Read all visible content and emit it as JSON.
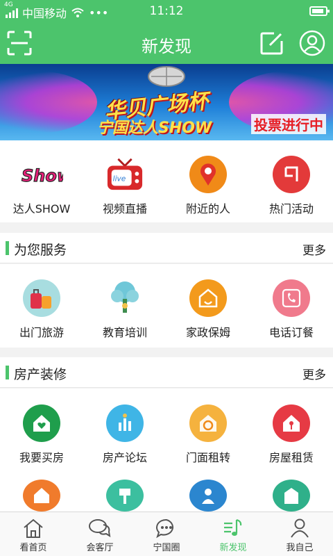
{
  "status": {
    "carrier": "中国移动",
    "network": "4G",
    "dots": "•••",
    "time": "11:12"
  },
  "header": {
    "title": "新发现",
    "left_icon": "scan-icon",
    "right_icons": [
      "edit-icon",
      "user-icon"
    ]
  },
  "banner": {
    "title": "华贝广场杯",
    "subtitle": "宁国达人SHOW",
    "vote_label": "投票进行中"
  },
  "featured": [
    {
      "label": "达人SHOW",
      "icon": "show-logo-icon",
      "color": "#e8207a"
    },
    {
      "label": "视频直播",
      "icon": "live-tv-icon",
      "color": "#d8292b"
    },
    {
      "label": "附近的人",
      "icon": "location-pin-icon",
      "color": "#f08a18"
    },
    {
      "label": "热门活动",
      "icon": "activity-flag-icon",
      "color": "#e33a3a"
    }
  ],
  "service_section": {
    "title": "为您服务",
    "more": "更多",
    "items": [
      {
        "label": "出门旅游",
        "icon": "luggage-icon",
        "color": "#a8dde0"
      },
      {
        "label": "教育培训",
        "icon": "education-tree-icon",
        "color": "#ffffff"
      },
      {
        "label": "家政保姆",
        "icon": "housekeeping-icon",
        "color": "#f39a1c"
      },
      {
        "label": "电话订餐",
        "icon": "phone-icon",
        "color": "#f07a8c"
      }
    ]
  },
  "house_section": {
    "title": "房产装修",
    "more": "更多",
    "items": [
      {
        "label": "我要买房",
        "icon": "buy-house-icon",
        "color": "#1f9e4c"
      },
      {
        "label": "房产论坛",
        "icon": "forum-chart-icon",
        "color": "#3fb5e6"
      },
      {
        "label": "门面租转",
        "icon": "shop-rent-icon",
        "color": "#f5b23e"
      },
      {
        "label": "房屋租赁",
        "icon": "house-lease-icon",
        "color": "#e63a44"
      }
    ],
    "items_row2": [
      {
        "icon": "house-icon",
        "color": "#f07b2c"
      },
      {
        "icon": "paint-brush-icon",
        "color": "#3cbf9f"
      },
      {
        "icon": "worker-icon",
        "color": "#2b86cf"
      },
      {
        "icon": "building-icon",
        "color": "#2fb08a"
      }
    ]
  },
  "tabbar": {
    "tabs": [
      {
        "label": "看首页",
        "icon": "home-icon"
      },
      {
        "label": "会客厅",
        "icon": "chat-icon"
      },
      {
        "label": "宁国圈",
        "icon": "message-dots-icon"
      },
      {
        "label": "新发现",
        "icon": "discover-icon",
        "active": true
      },
      {
        "label": "我自己",
        "icon": "profile-icon"
      }
    ]
  }
}
